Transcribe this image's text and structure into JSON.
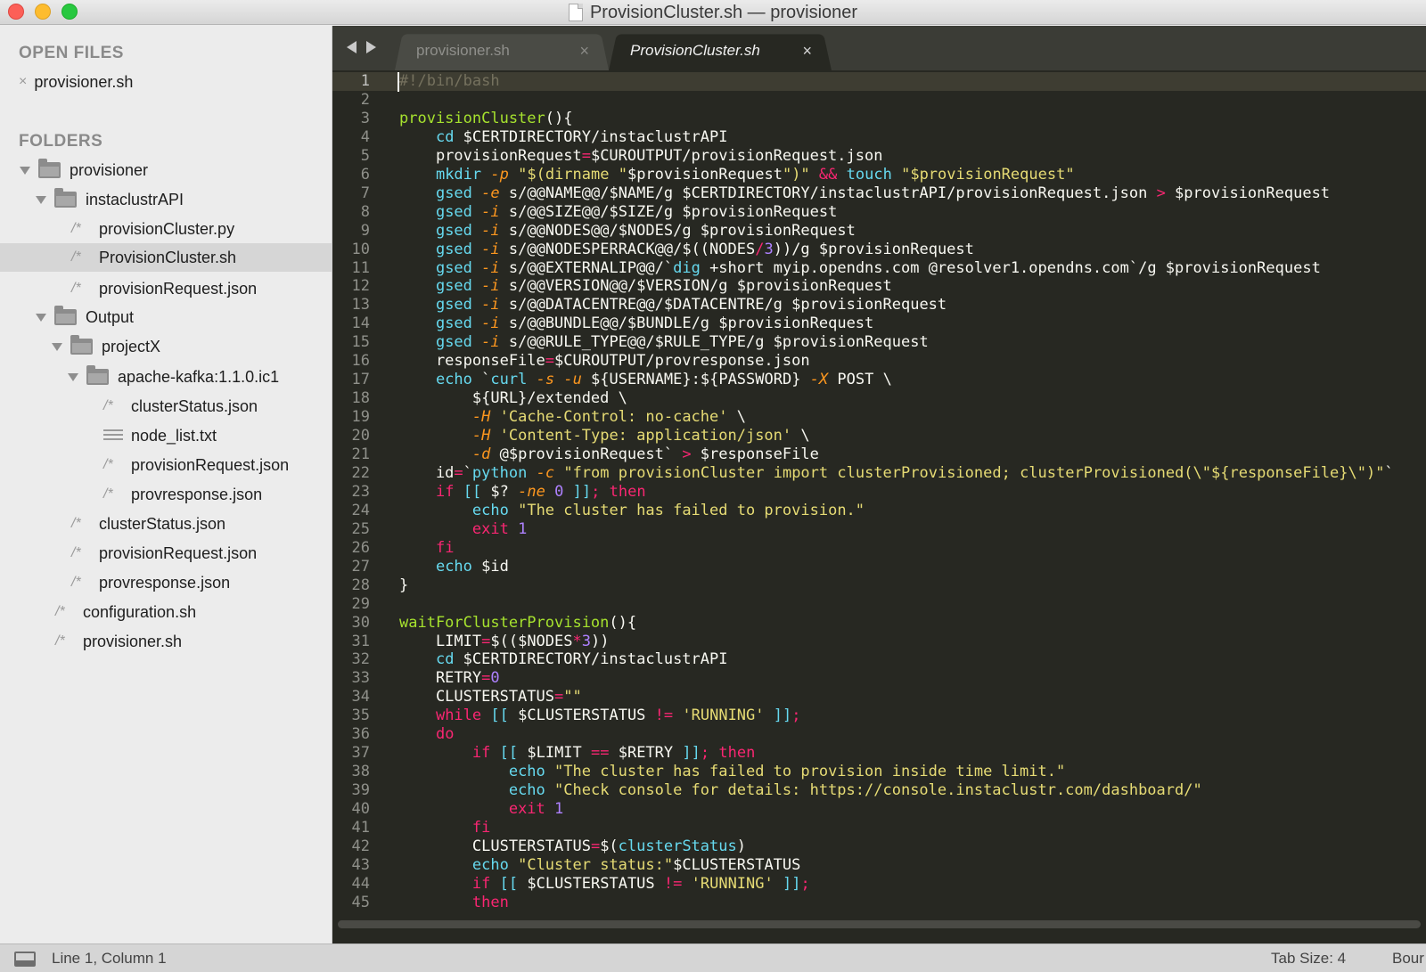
{
  "window": {
    "title": "ProvisionCluster.sh — provisioner"
  },
  "sidebar": {
    "open_files_heading": "OPEN FILES",
    "open_files": [
      {
        "label": "provisioner.sh"
      }
    ],
    "folders_heading": "FOLDERS",
    "tree": [
      {
        "label": "provisioner",
        "type": "folder",
        "depth": 0
      },
      {
        "label": "instaclustrAPI",
        "type": "folder",
        "depth": 1
      },
      {
        "label": "provisionCluster.py",
        "type": "file",
        "depth": 2
      },
      {
        "label": "ProvisionCluster.sh",
        "type": "file",
        "depth": 2,
        "selected": true
      },
      {
        "label": "provisionRequest.json",
        "type": "file",
        "depth": 2
      },
      {
        "label": "Output",
        "type": "folder",
        "depth": 1
      },
      {
        "label": "projectX",
        "type": "folder",
        "depth": 2
      },
      {
        "label": "apache-kafka:1.1.0.ic1",
        "type": "folder",
        "depth": 3
      },
      {
        "label": "clusterStatus.json",
        "type": "file",
        "depth": 4
      },
      {
        "label": "node_list.txt",
        "type": "text",
        "depth": 4
      },
      {
        "label": "provisionRequest.json",
        "type": "file",
        "depth": 4
      },
      {
        "label": "provresponse.json",
        "type": "file",
        "depth": 4
      },
      {
        "label": "clusterStatus.json",
        "type": "file",
        "depth": 2
      },
      {
        "label": "provisionRequest.json",
        "type": "file",
        "depth": 2
      },
      {
        "label": "provresponse.json",
        "type": "file",
        "depth": 2
      },
      {
        "label": "configuration.sh",
        "type": "file",
        "depth": 1
      },
      {
        "label": "provisioner.sh",
        "type": "file",
        "depth": 1
      }
    ]
  },
  "tabs": [
    {
      "label": "provisioner.sh",
      "close": "×",
      "active": false
    },
    {
      "label": "ProvisionCluster.sh",
      "close": "×",
      "active": true
    }
  ],
  "editor": {
    "lines": [
      "#!/bin/bash",
      "",
      "provisionCluster(){",
      "    cd $CERTDIRECTORY/instaclustrAPI",
      "    provisionRequest=$CUROUTPUT/provisionRequest.json",
      "    mkdir -p \"$(dirname \"$provisionRequest\")\" && touch \"$provisionRequest\"",
      "    gsed -e s/@@NAME@@/$NAME/g $CERTDIRECTORY/instaclustrAPI/provisionRequest.json > $provisionRequest",
      "    gsed -i s/@@SIZE@@/$SIZE/g $provisionRequest",
      "    gsed -i s/@@NODES@@/$NODES/g $provisionRequest",
      "    gsed -i s/@@NODESPERRACK@@/$((NODES/3))/g $provisionRequest",
      "    gsed -i s/@@EXTERNALIP@@/`dig +short myip.opendns.com @resolver1.opendns.com`/g $provisionRequest",
      "    gsed -i s/@@VERSION@@/$VERSION/g $provisionRequest",
      "    gsed -i s/@@DATACENTRE@@/$DATACENTRE/g $provisionRequest",
      "    gsed -i s/@@BUNDLE@@/$BUNDLE/g $provisionRequest",
      "    gsed -i s/@@RULE_TYPE@@/$RULE_TYPE/g $provisionRequest",
      "    responseFile=$CUROUTPUT/provresponse.json",
      "    echo `curl -s -u ${USERNAME}:${PASSWORD} -X POST \\",
      "        ${URL}/extended \\",
      "        -H 'Cache-Control: no-cache' \\",
      "        -H 'Content-Type: application/json' \\",
      "        -d @$provisionRequest` > $responseFile",
      "    id=`python -c \"from provisionCluster import clusterProvisioned; clusterProvisioned(\\\"${responseFile}\\\")\"`",
      "    if [[ $? -ne 0 ]]; then",
      "        echo \"The cluster has failed to provision.\"",
      "        exit 1",
      "    fi",
      "    echo $id",
      "}",
      "",
      "waitForClusterProvision(){",
      "    LIMIT=$(($NODES*3))",
      "    cd $CERTDIRECTORY/instaclustrAPI",
      "    RETRY=0",
      "    CLUSTERSTATUS=\"\"",
      "    while [[ $CLUSTERSTATUS != 'RUNNING' ]];",
      "    do",
      "        if [[ $LIMIT == $RETRY ]]; then",
      "            echo \"The cluster has failed to provision inside time limit.\"",
      "            echo \"Check console for details: https://console.instaclustr.com/dashboard/\"",
      "            exit 1",
      "        fi",
      "        CLUSTERSTATUS=$(clusterStatus)",
      "        echo \"Cluster status:\"$CLUSTERSTATUS",
      "        if [[ $CLUSTERSTATUS != 'RUNNING' ]];",
      "        then"
    ]
  },
  "status": {
    "position": "Line 1, Column 1",
    "tab_size": "Tab Size: 4",
    "syntax": "Bour"
  }
}
